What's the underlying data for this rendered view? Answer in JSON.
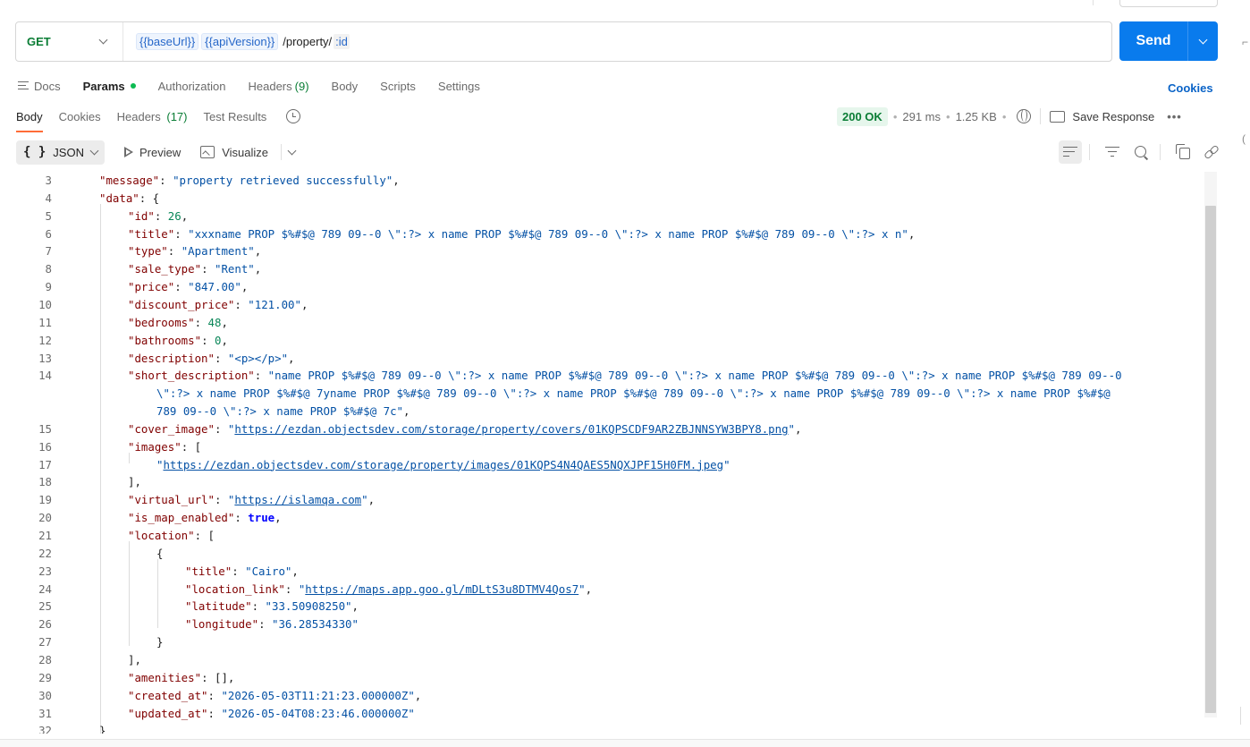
{
  "request": {
    "method": "GET",
    "url_vars": [
      "{{baseUrl}}",
      "{{apiVersion}}"
    ],
    "url_path": "/property/",
    "url_path_var": ":id",
    "send_label": "Send"
  },
  "request_tabs": {
    "docs": "Docs",
    "params": "Params",
    "authorization": "Authorization",
    "headers": "Headers",
    "headers_count": "(9)",
    "body": "Body",
    "scripts": "Scripts",
    "settings": "Settings",
    "cookies": "Cookies"
  },
  "response_tabs": {
    "body": "Body",
    "cookies": "Cookies",
    "headers": "Headers",
    "headers_count": "(17)",
    "test_results": "Test Results"
  },
  "response_status": {
    "status": "200 OK",
    "time": "291 ms",
    "size": "1.25 KB",
    "save_label": "Save Response",
    "more": "•••"
  },
  "toolbar": {
    "format": "JSON",
    "preview": "Preview",
    "visualize": "Visualize"
  },
  "icons": {
    "docs": "docs-icon",
    "history": "history-icon",
    "globe": "globe-icon",
    "save": "save-icon",
    "preview": "preview-icon",
    "visualize": "image-icon",
    "wrap": "wrap-lines-icon",
    "filter": "filter-icon",
    "search": "search-icon",
    "copy": "copy-icon",
    "link": "link-icon"
  },
  "code": {
    "line_numbers": [
      "3",
      "4",
      "5",
      "6",
      "7",
      "8",
      "9",
      "10",
      "11",
      "12",
      "13",
      "14",
      "15",
      "16",
      "17",
      "18",
      "19",
      "20",
      "21",
      "22",
      "23",
      "24",
      "25",
      "26",
      "27",
      "28",
      "29",
      "30",
      "31",
      "32"
    ],
    "tokens": {
      "message_key": "\"message\"",
      "message_val": "\"property retrieved successfully\"",
      "data_key": "\"data\"",
      "id_key": "\"id\"",
      "id_val": "26",
      "title_key": "\"title\"",
      "title_val": "\"xxxname PROP $%#$@ 789 09--0 \\\":?> x name PROP $%#$@ 789 09--0 \\\":?> x name PROP $%#$@ 789 09--0 \\\":?> x n\"",
      "type_key": "\"type\"",
      "type_val": "\"Apartment\"",
      "sale_type_key": "\"sale_type\"",
      "sale_type_val": "\"Rent\"",
      "price_key": "\"price\"",
      "price_val": "\"847.00\"",
      "discount_key": "\"discount_price\"",
      "discount_val": "\"121.00\"",
      "bedrooms_key": "\"bedrooms\"",
      "bedrooms_val": "48",
      "bathrooms_key": "\"bathrooms\"",
      "bathrooms_val": "0",
      "description_key": "\"description\"",
      "description_val": "\"<p></p>\"",
      "short_desc_key": "\"short_description\"",
      "short_desc_val_1": "\"name PROP $%#$@ 789 09--0 \\\":?> x name PROP $%#$@ 789 09--0 \\\":?> x name PROP $%#$@ 789 09--0 \\\":?> x name PROP $%#$@ 789 09--0",
      "short_desc_val_2": "\\\":?> x name PROP $%#$@ 7yname PROP $%#$@ 789 09--0 \\\":?> x name PROP $%#$@ 789 09--0 \\\":?> x name PROP $%#$@ 789 09--0 \\\":?> x name PROP $%#$@",
      "short_desc_val_3": "789 09--0 \\\":?> x name PROP $%#$@ 7c\"",
      "cover_key": "\"cover_image\"",
      "cover_url": "https://ezdan.objectsdev.com/storage/property/covers/01KQPSCDF9AR2ZBJNNSYW3BPY8.png",
      "images_key": "\"images\"",
      "image_url": "https://ezdan.objectsdev.com/storage/property/images/01KQPS4N4QAES5NQXJPF15H0FM.jpeg",
      "virtual_key": "\"virtual_url\"",
      "virtual_url": "https://islamqa.com",
      "map_key": "\"is_map_enabled\"",
      "map_val": "true",
      "location_key": "\"location\"",
      "loc_title_key": "\"title\"",
      "loc_title_val": "\"Cairo\"",
      "loc_link_key": "\"location_link\"",
      "loc_link_url": "https://maps.app.goo.gl/mDLtS3u8DTMV4Qos7",
      "lat_key": "\"latitude\"",
      "lat_val": "\"33.50908250\"",
      "lng_key": "\"longitude\"",
      "lng_val": "\"36.28534330\"",
      "amenities_key": "\"amenities\"",
      "created_key": "\"created_at\"",
      "created_val": "\"2026-05-03T11:21:23.000000Z\"",
      "updated_key": "\"updated_at\"",
      "updated_val": "\"2026-05-04T08:23:46.000000Z\""
    }
  }
}
